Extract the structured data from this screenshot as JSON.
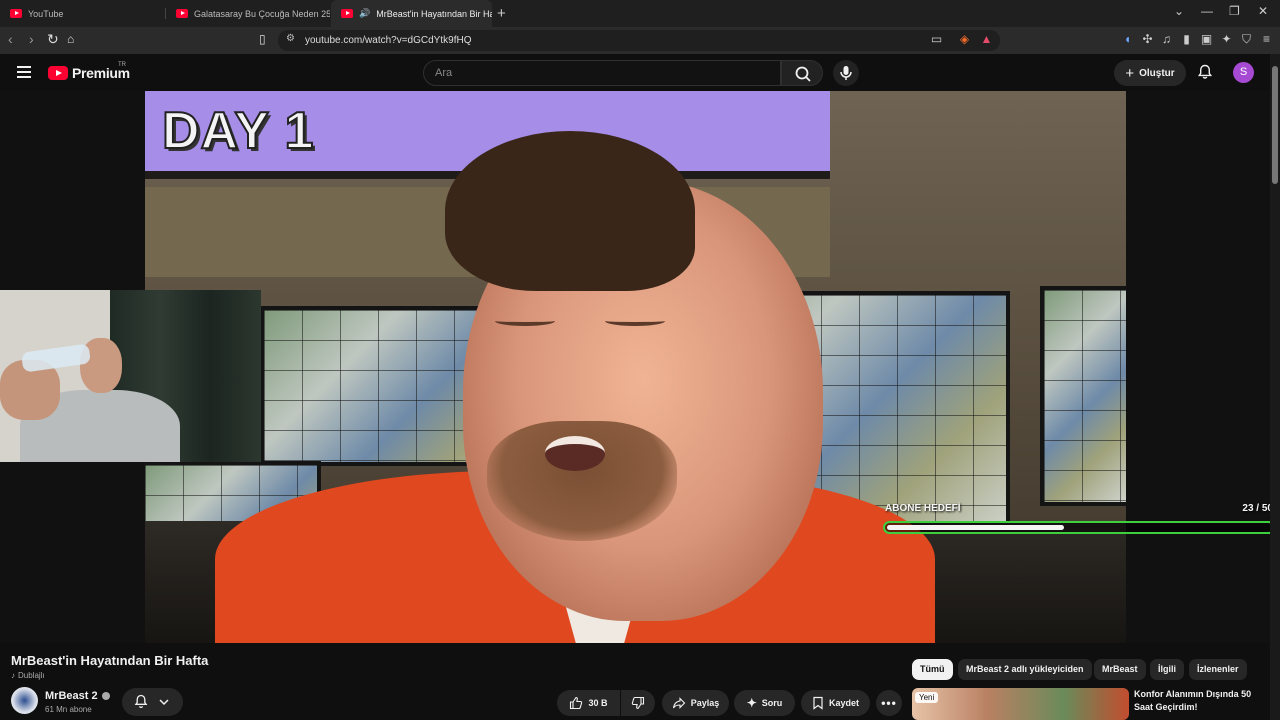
{
  "browser": {
    "tabs": [
      {
        "title": "YouTube"
      },
      {
        "title": "Galatasaray Bu Çocuğa Neden 25 M"
      },
      {
        "title": "MrBeast'in Hayatından Bir Ha"
      }
    ],
    "url": "youtube.com/watch?v=dGCdYtk9fHQ"
  },
  "header": {
    "logo": "Premium",
    "region": "TR",
    "search_placeholder": "Ara",
    "create_label": "Oluştur",
    "avatar_letter": "S"
  },
  "video": {
    "overlay_text": "DAY 1",
    "sub_goal": {
      "label": "ABONE HEDEFİ",
      "current": "23",
      "target": "50",
      "count_text": "23 / 50",
      "progress": 0.46
    }
  },
  "info": {
    "title": "MrBeast'in Hayatından Bir Hafta",
    "dub_label": "Dublajlı",
    "channel": "MrBeast 2",
    "subscribers": "61 Mn abone",
    "likes": "30 B",
    "share": "Paylaş",
    "ask": "Soru",
    "save": "Kaydet"
  },
  "chips": [
    {
      "label": "Tümü",
      "active": true
    },
    {
      "label": "MrBeast 2 adlı yükleyiciden"
    },
    {
      "label": "MrBeast"
    },
    {
      "label": "İlgili"
    },
    {
      "label": "İzlenenler"
    }
  ],
  "recommendation": {
    "badge": "Yeni",
    "title": "Konfor Alanımın Dışında 50 Saat Geçirdim!"
  },
  "colors": {
    "brand": "#ff0033",
    "avatar": "#a74ad3",
    "goal_border": "#3ecf3e",
    "jumpsuit": "#e0481f"
  }
}
